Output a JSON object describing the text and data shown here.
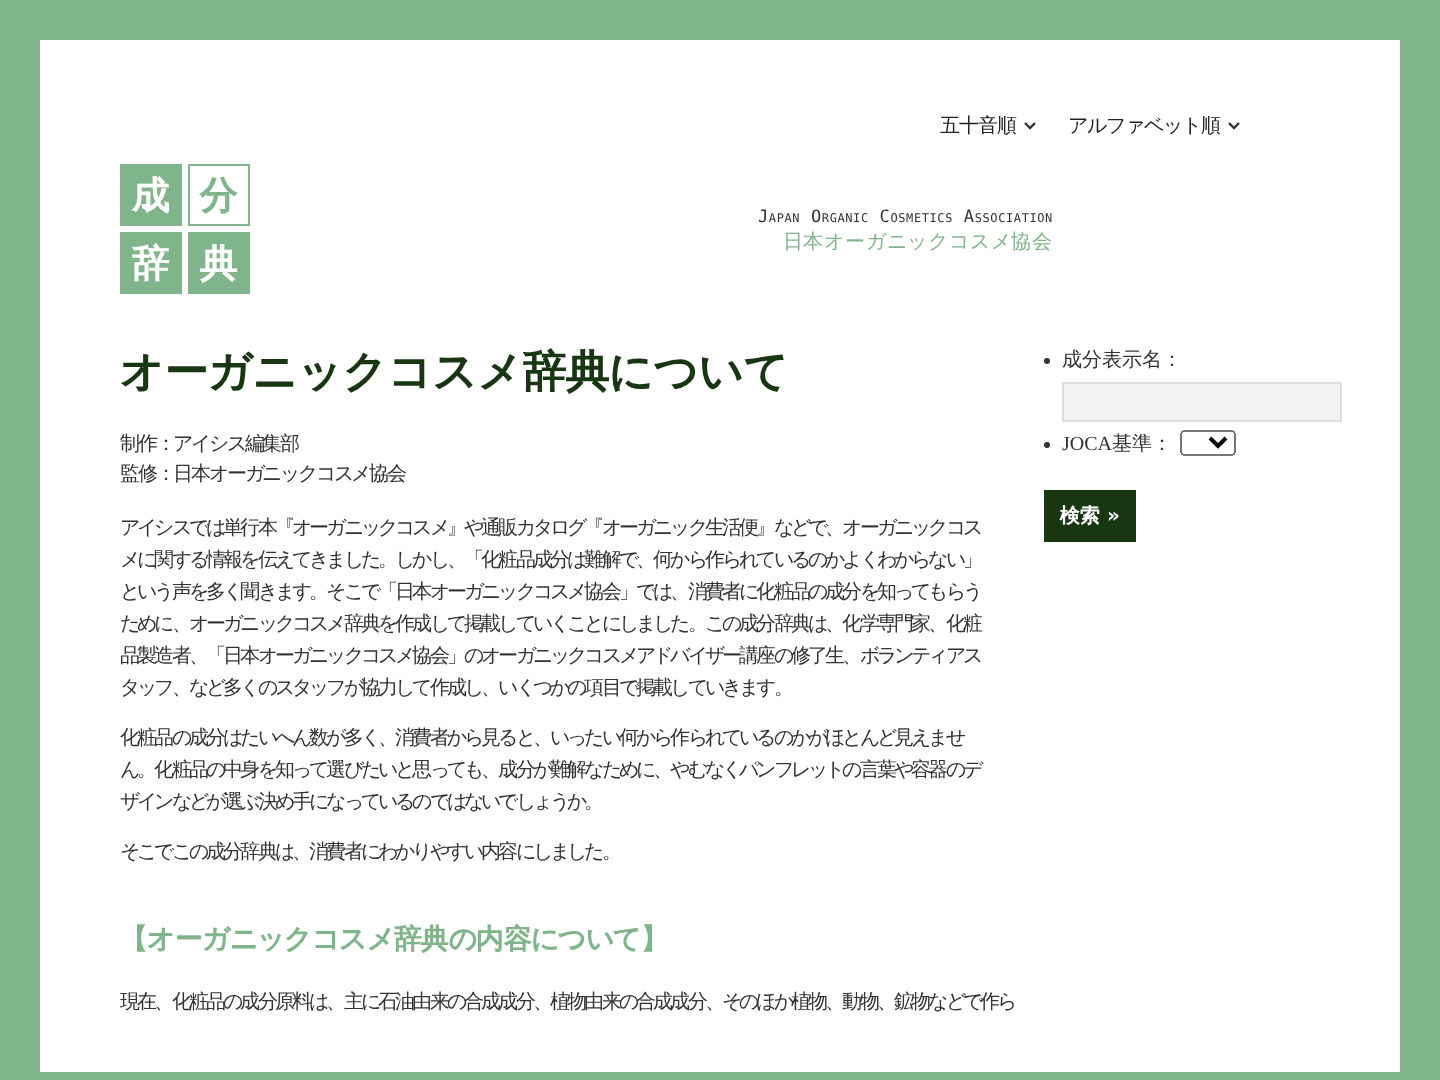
{
  "nav": [
    {
      "label": "五十音順"
    },
    {
      "label": "アルファベット順"
    }
  ],
  "logo": [
    {
      "char": "成",
      "filled": true
    },
    {
      "char": "分",
      "filled": false
    },
    {
      "char": "辞",
      "filled": true
    },
    {
      "char": "典",
      "filled": true
    }
  ],
  "tagline": {
    "en": "Japan Organic Cosmetics Association",
    "ja": "日本オーガニックコスメ協会"
  },
  "title": "オーガニックコスメ辞典について",
  "credits": [
    "制作：アイシス編集部",
    "監修：日本オーガニックコスメ協会"
  ],
  "paragraphs": [
    "アイシスでは単行本『オーガニックコスメ』や通販カタログ『オーガニック生活便』などで、オーガニックコスメに関する情報を伝えてきました。しかし、「化粧品成分は難解で、何から作られているのかよくわからない」という声を多く聞きます。そこで「日本オーガニックコスメ協会」では、消費者に化粧品の成分を知ってもらうために、オーガニックコスメ辞典を作成して掲載していくことにしました。この成分辞典は、化学専門家、化粧品製造者、「日本オーガニックコスメ協会」のオーガニックコスメアドバイザー講座の修了生、ボランティアスタッフ、など多くのスタッフが協力して作成し、いくつかの項目で掲載していきます。",
    "化粧品の成分はたいへん数が多く、消費者から見ると、いったい何から作られているのかがほとんど見えません。化粧品の中身を知って選びたいと思っても、成分が難解なために、やむなくパンフレットの言葉や容器のデザインなどが選ぶ決め手になっているのではないでしょうか。",
    "そこでこの成分辞典は、消費者にわかりやすい内容にしました。"
  ],
  "section_heading": "【オーガニックコスメ辞典の内容について】",
  "last_line": "現在、化粧品の成分原料は、主に石油由来の合成成分、植物由来の合成成分、そのほか植物、動物、鉱物などで作ら",
  "search": {
    "fields": [
      {
        "kind": "text",
        "label": "成分表示名："
      },
      {
        "kind": "select",
        "label": "JOCA基準："
      }
    ],
    "button": "検索 »"
  }
}
